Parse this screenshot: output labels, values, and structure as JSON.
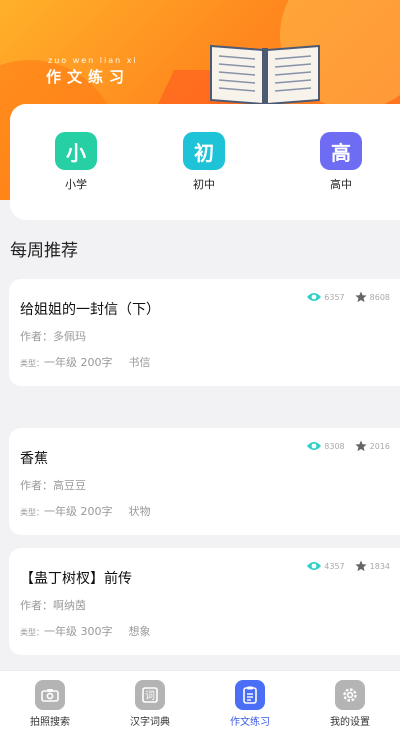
{
  "header": {
    "pinyin": "zuo wen lian xi",
    "title": "作文练习"
  },
  "levels": [
    {
      "icon_char": "小",
      "label": "小学",
      "color": "#27cfa4"
    },
    {
      "icon_char": "初",
      "label": "初中",
      "color": "#1fc3d7"
    },
    {
      "icon_char": "高",
      "label": "高中",
      "color": "#6d6cf3"
    }
  ],
  "weekly": {
    "title": "每周推荐",
    "articles": [
      {
        "title": "给姐姐的一封信（下）",
        "author": "作者：多佩玛",
        "type_label": "类型：",
        "grade": "一年级",
        "words": "200字",
        "category": "书信",
        "views": "6357",
        "stars": "8608"
      },
      {
        "title": "香蕉",
        "author": "作者：高豆豆",
        "type_label": "类型：",
        "grade": "一年级",
        "words": "200字",
        "category": "状物",
        "views": "8308",
        "stars": "2016"
      },
      {
        "title": "【蛊丁树杈】前传",
        "author": "作者：啊纳茵",
        "type_label": "类型：",
        "grade": "一年级",
        "words": "300字",
        "category": "想象",
        "views": "4357",
        "stars": "1834"
      }
    ]
  },
  "nav": {
    "items": [
      {
        "label": "拍照搜索",
        "icon": "camera-icon"
      },
      {
        "label": "汉字词典",
        "icon": "dictionary-icon"
      },
      {
        "label": "作文练习",
        "icon": "document-icon"
      },
      {
        "label": "我的设置",
        "icon": "gear-icon"
      }
    ],
    "active_color": "#4a6ef5"
  },
  "colors": {
    "banner_start": "#ffb12a",
    "banner_end": "#ff6a1c",
    "view_icon": "#2fd0c8",
    "star_icon": "#666666"
  }
}
